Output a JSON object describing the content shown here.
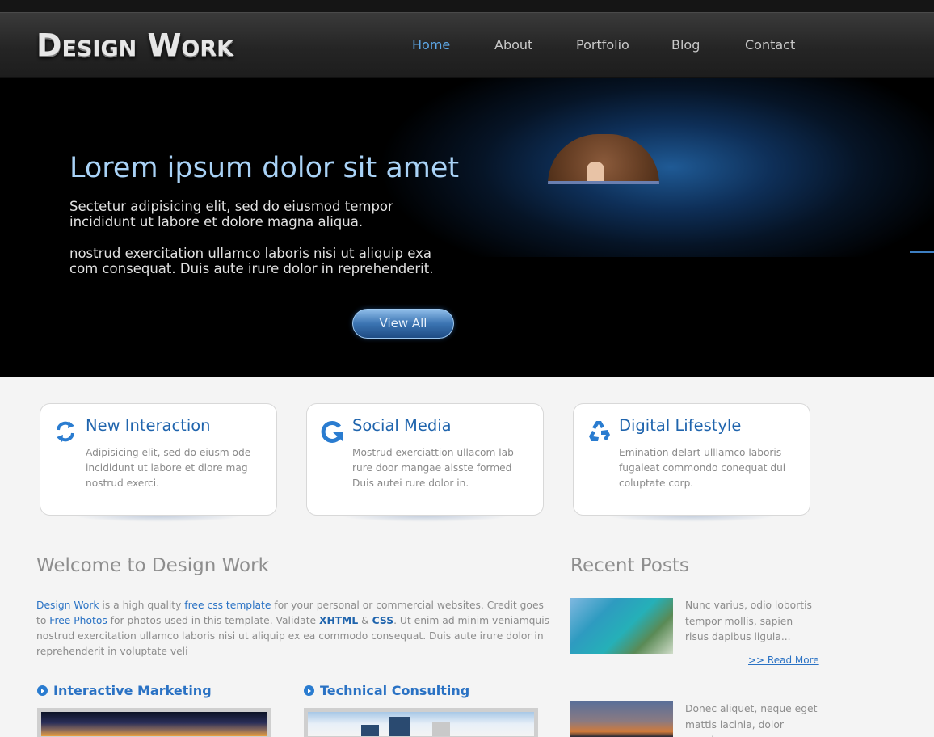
{
  "header": {
    "logo": "Design Work",
    "nav": [
      {
        "label": "Home",
        "active": true
      },
      {
        "label": "About",
        "active": false
      },
      {
        "label": "Portfolio",
        "active": false
      },
      {
        "label": "Blog",
        "active": false
      },
      {
        "label": "Contact",
        "active": false
      }
    ]
  },
  "hero": {
    "title": "Lorem ipsum dolor sit amet",
    "paragraph1": "Sectetur adipisicing elit, sed do eiusmod tempor incididunt ut labore et dolore magna aliqua.",
    "paragraph2": "nostrud exercitation ullamco laboris nisi ut aliquip exa com consequat. Duis aute irure dolor in reprehenderit.",
    "button": "View All"
  },
  "features": [
    {
      "title": "New Interaction",
      "text": "Adipisicing elit, sed do eiusm ode incididunt ut labore et dlore mag nostrud exerci.",
      "icon": "refresh-arrows-icon"
    },
    {
      "title": "Social Media",
      "text": "Mostrud exerciattion ullacom lab rure door mangae alsste formed Duis autei rure dolor in.",
      "icon": "circular-arrow-icon"
    },
    {
      "title": "Digital Lifestyle",
      "text": "Emination delart ulllamco laboris fugaieat commondo conequat dui coluptate corp.",
      "icon": "recycle-icon"
    }
  ],
  "welcome": {
    "title": "Welcome to Design Work",
    "link_design_work": "Design Work",
    "text_1": " is a high quality ",
    "link_template": "free css template",
    "text_2": " for your personal or commercial websites. Credit goes to ",
    "link_photos": "Free Photos",
    "text_3": " for photos used in this template. Validate ",
    "link_xhtml": "XHTML",
    "text_4": " & ",
    "link_css": "CSS",
    "text_5": ". Ut enim ad minim veniamquis nostrud exercitation ullamco laboris nisi ut aliquip ex ea commodo consequat. Duis aute irure dolor in reprehenderit in voluptate veli"
  },
  "sections": [
    {
      "title": "Interactive Marketing"
    },
    {
      "title": "Technical Consulting"
    }
  ],
  "recent": {
    "title": "Recent Posts",
    "posts": [
      {
        "text": "Nunc varius, odio lobortis tempor mollis, sapien risus dapibus ligula...",
        "read_more": ">> Read More"
      },
      {
        "text": "Donec aliquet, neque eget mattis lacinia, dolor mauris"
      }
    ]
  }
}
